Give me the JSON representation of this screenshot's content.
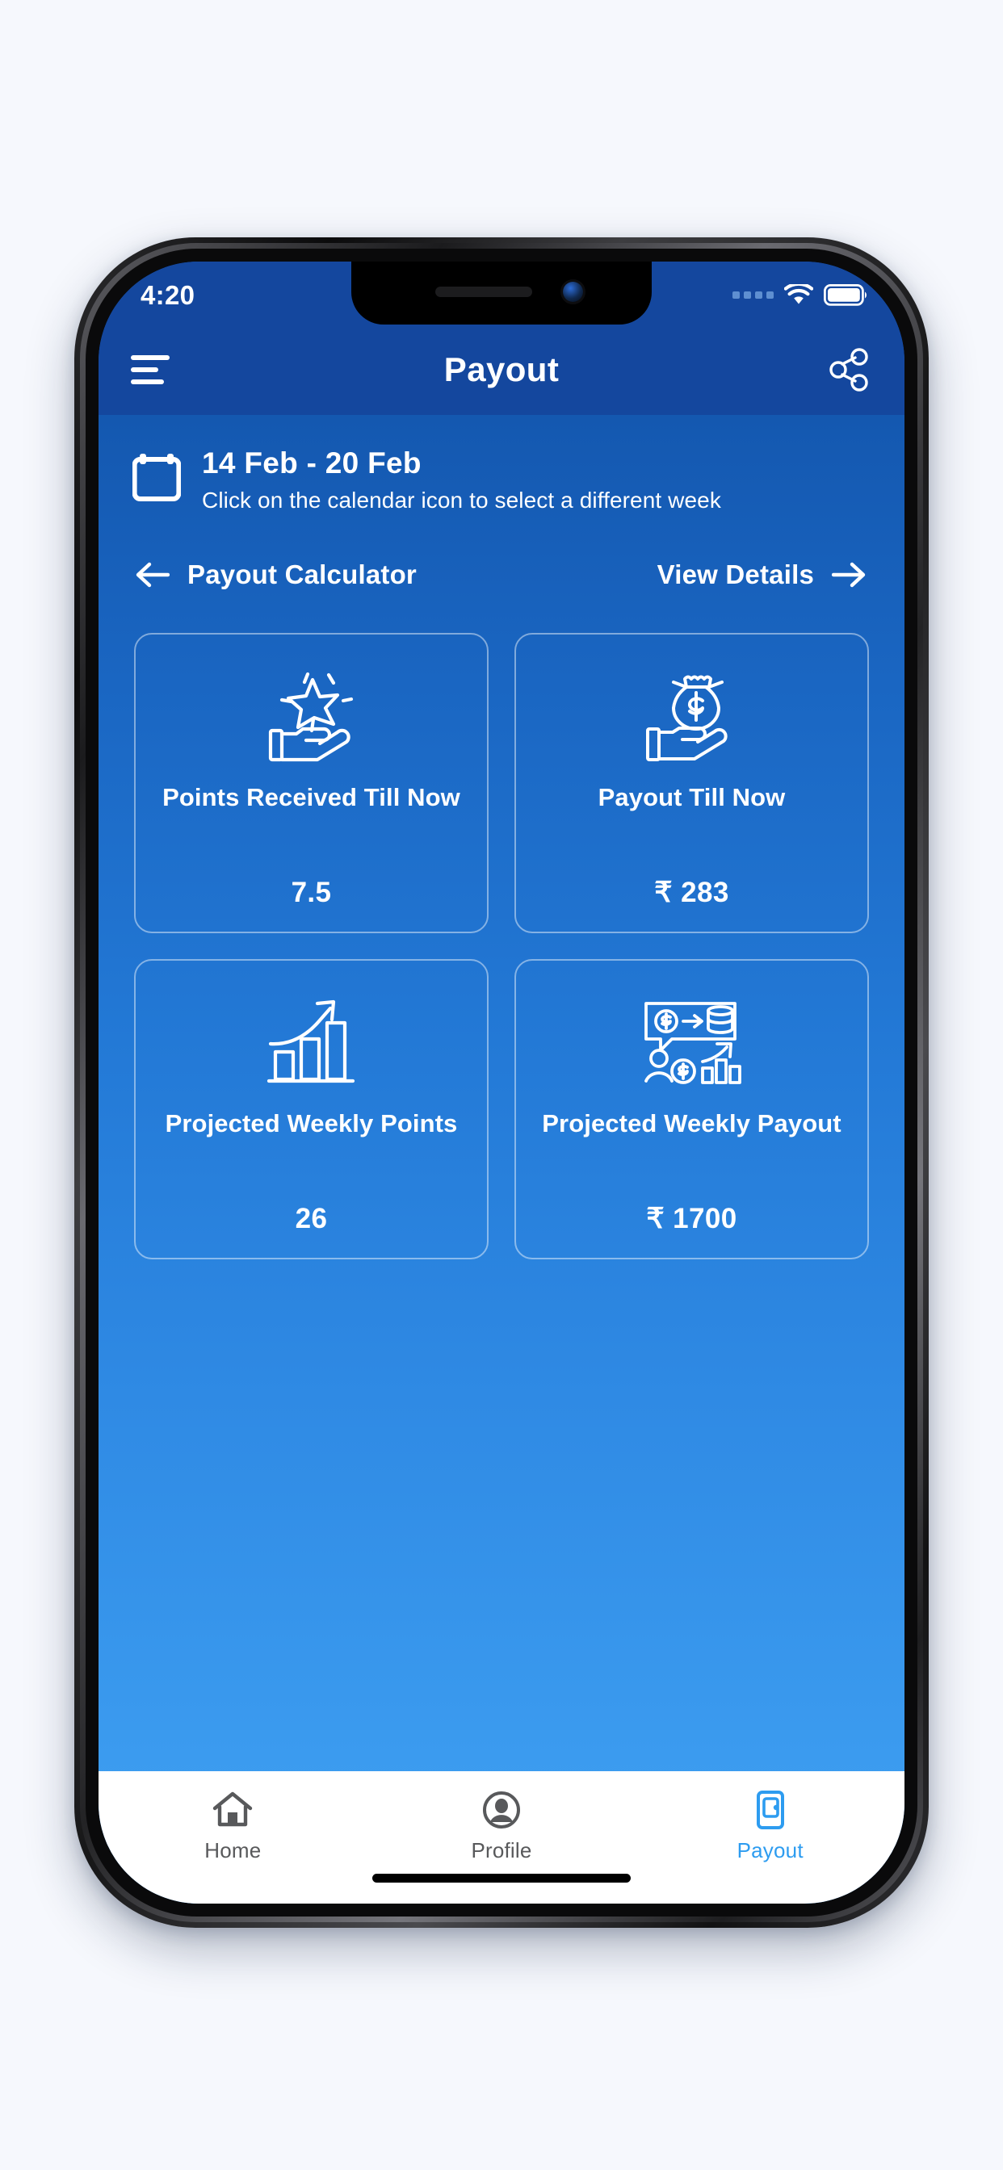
{
  "status_bar": {
    "time": "4:20",
    "signal_icon": "signal-dots-icon",
    "wifi_icon": "wifi-icon",
    "battery_icon": "battery-full-icon"
  },
  "header": {
    "menu_icon": "hamburger-menu-icon",
    "title": "Payout",
    "share_icon": "share-icon"
  },
  "date_selector": {
    "calendar_icon": "calendar-icon",
    "range": "14 Feb - 20 Feb",
    "hint": "Click on the calendar icon to select a different week"
  },
  "nav_row": {
    "back_icon": "arrow-left-icon",
    "back_label": "Payout Calculator",
    "forward_label": "View Details",
    "forward_icon": "arrow-right-icon"
  },
  "cards": [
    {
      "icon": "hand-holding-star-icon",
      "title": "Points Received Till Now",
      "value": "7.5"
    },
    {
      "icon": "hand-holding-money-bag-icon",
      "title": "Payout Till Now",
      "value": "₹ 283"
    },
    {
      "icon": "growth-bar-chart-icon",
      "title": "Projected Weekly Points",
      "value": "26"
    },
    {
      "icon": "payout-projection-icon",
      "title": "Projected Weekly Payout",
      "value": "₹ 1700"
    }
  ],
  "bottom_nav": [
    {
      "icon": "home-icon",
      "label": "Home",
      "active": false
    },
    {
      "icon": "profile-icon",
      "label": "Profile",
      "active": false
    },
    {
      "icon": "wallet-icon",
      "label": "Payout",
      "active": true
    }
  ],
  "colors": {
    "page_background": "#f6f8fd",
    "header_blue": "#14479e",
    "body_gradient_top": "#1458b0",
    "body_gradient_bottom": "#3f9ff2",
    "nav_active": "#2d9cf0",
    "nav_inactive": "#58595b",
    "card_border": "rgba(255,255,255,0.45)",
    "text_white": "#ffffff"
  }
}
